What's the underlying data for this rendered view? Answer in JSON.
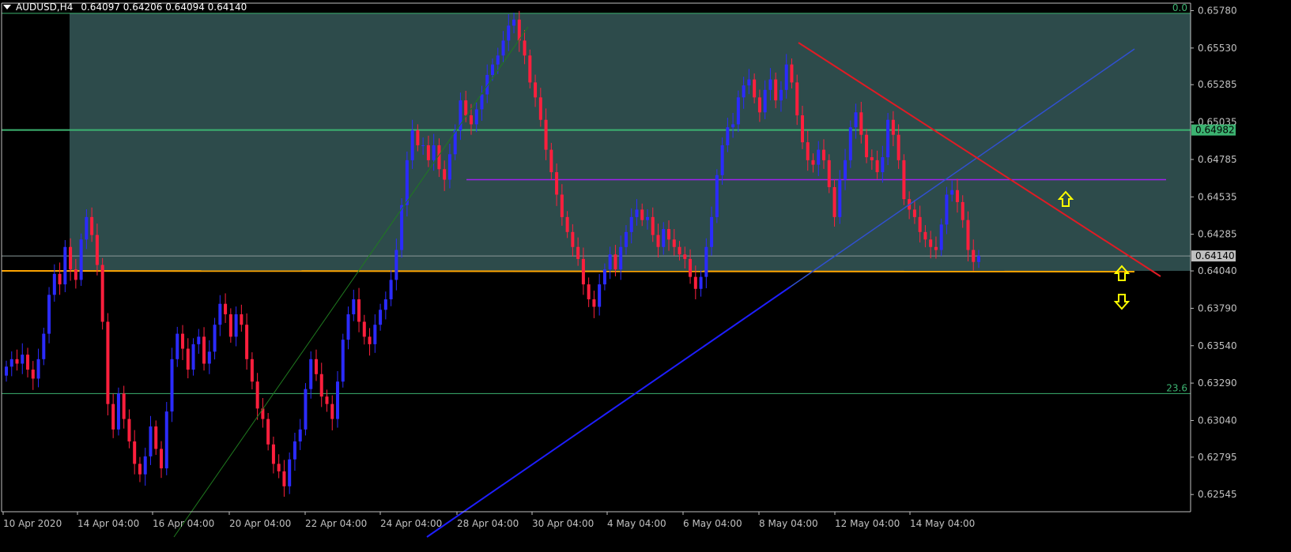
{
  "header": {
    "symbol": "AUDUSD,H4",
    "ohlc": "0.64097 0.64206 0.64094 0.64140"
  },
  "colors": {
    "background": "#000000",
    "bull": "#2B2BFF",
    "bear": "#FF1F3D",
    "fib_zone": "#2F4F4F",
    "level_green": "#3CB371",
    "level_orange": "#FFA500",
    "trend_blue": "#1E1EFF",
    "trend_red": "#E01B24",
    "trend_green": "#1F7A1F",
    "mid_purple": "#A020F0",
    "arrow": "#FFFF00",
    "axis": "#C0C0C0",
    "current_price": "#C0C0C0"
  },
  "chart_data": {
    "type": "candlestick",
    "symbol": "AUDUSD",
    "timeframe": "H4",
    "ylim": [
      0.6243,
      0.6583
    ],
    "y_ticks": [
      "0.65780",
      "0.65530",
      "0.65285",
      "0.65035",
      "0.64785",
      "0.64535",
      "0.64285",
      "0.64040",
      "0.63790",
      "0.63540",
      "0.63290",
      "0.63040",
      "0.62795",
      "0.62545"
    ],
    "x_labels": [
      "10 Apr 2020",
      "14 Apr 04:00",
      "16 Apr 04:00",
      "20 Apr 04:00",
      "22 Apr 04:00",
      "24 Apr 04:00",
      "28 Apr 04:00",
      "30 Apr 04:00",
      "4 May 04:00",
      "6 May 04:00",
      "8 May 04:00",
      "12 May 04:00",
      "14 May 04:00"
    ],
    "levels": [
      {
        "name": "fib-0.0",
        "price": 0.65762,
        "label": "0.0"
      },
      {
        "name": "fib-23.6",
        "price": 0.6322,
        "label": "23.6"
      },
      {
        "name": "resistance-green",
        "price": 0.64982,
        "label": "0.64982"
      },
      {
        "name": "current-price",
        "price": 0.6414,
        "label": "0.64140"
      },
      {
        "name": "support-orange",
        "price": 0.6404
      },
      {
        "name": "mid-purple",
        "price": 0.6465
      }
    ],
    "candles_close": [
      0.634,
      0.6345,
      0.6342,
      0.6348,
      0.6338,
      0.6332,
      0.6345,
      0.6362,
      0.6388,
      0.6402,
      0.6395,
      0.642,
      0.6405,
      0.6398,
      0.6425,
      0.644,
      0.6428,
      0.6408,
      0.637,
      0.6315,
      0.6298,
      0.6322,
      0.6305,
      0.629,
      0.6275,
      0.6268,
      0.628,
      0.63,
      0.6285,
      0.6272,
      0.631,
      0.6345,
      0.6362,
      0.6352,
      0.6338,
      0.6355,
      0.636,
      0.6342,
      0.635,
      0.6368,
      0.6382,
      0.6375,
      0.636,
      0.6375,
      0.6368,
      0.6345,
      0.633,
      0.6312,
      0.6305,
      0.6288,
      0.6275,
      0.627,
      0.626,
      0.6278,
      0.629,
      0.6298,
      0.6325,
      0.6345,
      0.6335,
      0.632,
      0.6315,
      0.6305,
      0.633,
      0.6358,
      0.6375,
      0.6385,
      0.637,
      0.636,
      0.6355,
      0.6368,
      0.6378,
      0.6385,
      0.6398,
      0.6418,
      0.6448,
      0.6478,
      0.6498,
      0.6488,
      0.6488,
      0.6478,
      0.6488,
      0.6472,
      0.6465,
      0.6482,
      0.6498,
      0.6518,
      0.6508,
      0.6502,
      0.6512,
      0.6522,
      0.6535,
      0.6542,
      0.6548,
      0.6558,
      0.6568,
      0.6572,
      0.6558,
      0.6548,
      0.653,
      0.652,
      0.6505,
      0.6485,
      0.647,
      0.6455,
      0.644,
      0.643,
      0.642,
      0.6412,
      0.6395,
      0.6385,
      0.638,
      0.6395,
      0.6405,
      0.6415,
      0.6405,
      0.642,
      0.643,
      0.644,
      0.6445,
      0.6438,
      0.644,
      0.6428,
      0.642,
      0.6432,
      0.6425,
      0.642,
      0.6415,
      0.6412,
      0.64,
      0.6392,
      0.64,
      0.642,
      0.644,
      0.6468,
      0.6488,
      0.65,
      0.6502,
      0.652,
      0.6528,
      0.6532,
      0.652,
      0.651,
      0.6525,
      0.6532,
      0.6518,
      0.6525,
      0.6542,
      0.653,
      0.6508,
      0.649,
      0.6478,
      0.6475,
      0.6485,
      0.6478,
      0.646,
      0.644,
      0.6465,
      0.6478,
      0.65,
      0.651,
      0.6495,
      0.648,
      0.6478,
      0.647,
      0.648,
      0.6505,
      0.6495,
      0.6478,
      0.6452,
      0.6445,
      0.644,
      0.643,
      0.6425,
      0.642,
      0.6418,
      0.6435,
      0.6455,
      0.6458,
      0.645,
      0.6438,
      0.6418,
      0.641,
      0.6414
    ]
  }
}
